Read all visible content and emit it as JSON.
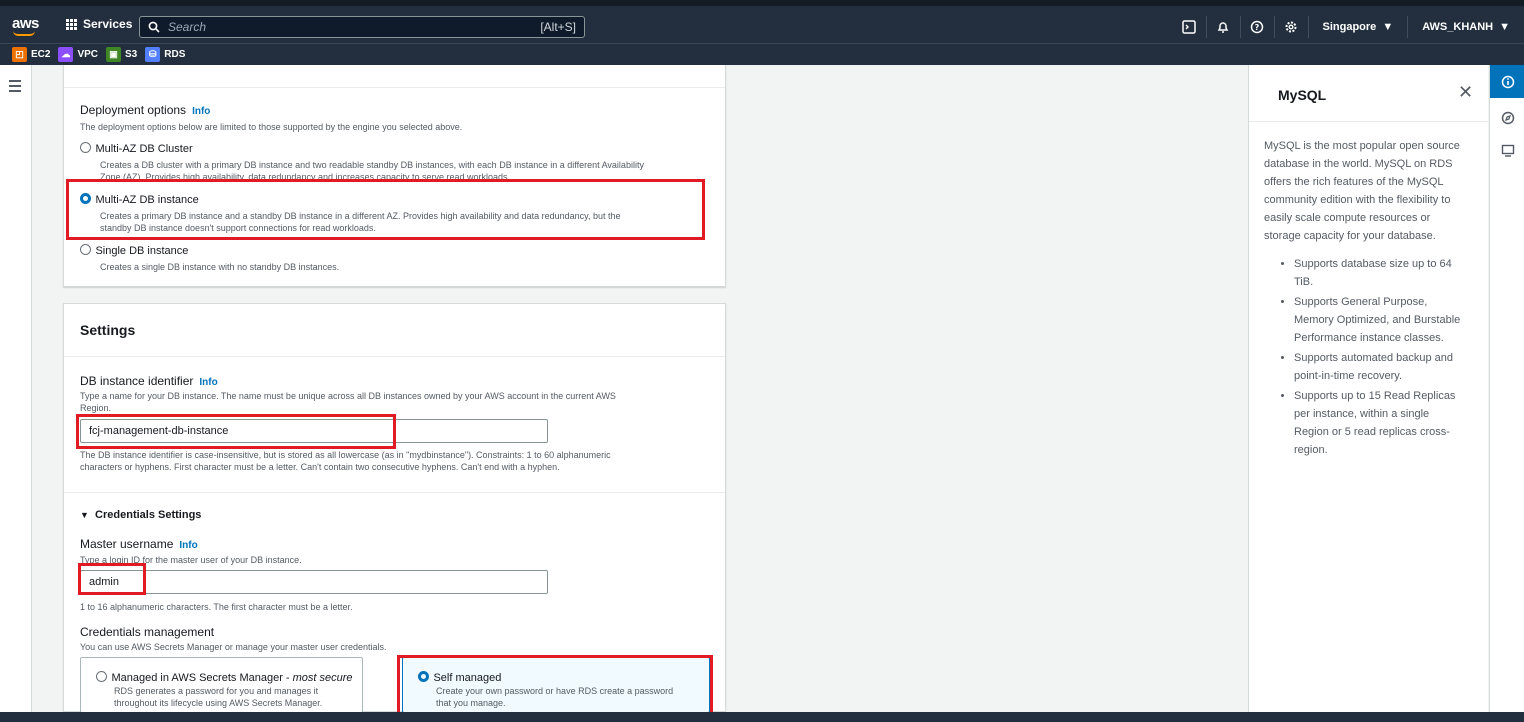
{
  "topbar": {
    "logo": "aws",
    "services_label": "Services",
    "search_placeholder": "Search",
    "search_shortcut": "[Alt+S]",
    "region": "Singapore",
    "account": "AWS_KHANH"
  },
  "favorites": [
    {
      "label": "EC2",
      "color": "#ed7100"
    },
    {
      "label": "VPC",
      "color": "#8c4fff"
    },
    {
      "label": "S3",
      "color": "#3f8624"
    },
    {
      "label": "RDS",
      "color": "#527fff"
    }
  ],
  "deployment": {
    "heading": "Deployment options",
    "info": "Info",
    "description": "The deployment options below are limited to those supported by the engine you selected above.",
    "options": [
      {
        "title": "Multi-AZ DB Cluster",
        "desc1": "Creates a DB cluster with a primary DB instance and two readable standby DB instances, with each DB instance in a different Availability",
        "desc2": "Zone (AZ). Provides high availability, data redundancy and increases capacity to serve read workloads.",
        "selected": false
      },
      {
        "title": "Multi-AZ DB instance",
        "desc1": "Creates a primary DB instance and a standby DB instance in a different AZ. Provides high availability and data redundancy, but the",
        "desc2": "standby DB instance doesn't support connections for read workloads.",
        "selected": true
      },
      {
        "title": "Single DB instance",
        "desc1": "Creates a single DB instance with no standby DB instances.",
        "desc2": "",
        "selected": false
      }
    ]
  },
  "settings": {
    "heading": "Settings",
    "identifier": {
      "label": "DB instance identifier",
      "info": "Info",
      "desc1": "Type a name for your DB instance. The name must be unique across all DB instances owned by your AWS account in the current AWS",
      "desc2": "Region.",
      "value": "fcj-management-db-instance",
      "hint1": "The DB instance identifier is case-insensitive, but is stored as all lowercase (as in \"mydbinstance\"). Constraints: 1 to 60 alphanumeric",
      "hint2": "characters or hyphens. First character must be a letter. Can't contain two consecutive hyphens. Can't end with a hyphen."
    },
    "credentials": {
      "heading": "Credentials Settings",
      "username_label": "Master username",
      "info": "Info",
      "username_desc": "Type a login ID for the master user of your DB instance.",
      "username_value": "admin",
      "username_hint": "1 to 16 alphanumeric characters. The first character must be a letter.",
      "mgmt_label": "Credentials management",
      "mgmt_desc": "You can use AWS Secrets Manager or manage your master user credentials.",
      "managed": {
        "title": "Managed in AWS Secrets Manager - ",
        "title_em": "most secure",
        "desc1": "RDS generates a password for you and manages it",
        "desc2": "throughout its lifecycle using AWS Secrets Manager.",
        "selected": false
      },
      "self": {
        "title": "Self managed",
        "desc1": "Create your own password or have RDS create a password",
        "desc2": "that you manage.",
        "selected": true
      }
    }
  },
  "help_panel": {
    "title": "MySQL",
    "intro": "MySQL is the most popular open source database in the world. MySQL on RDS offers the rich features of the MySQL community edition with the flexibility to easily scale compute resources or storage capacity for your database.",
    "bullets": [
      "Supports database size up to 64 TiB.",
      "Supports General Purpose, Memory Optimized, and Burstable Performance instance classes.",
      "Supports automated backup and point-in-time recovery.",
      "Supports up to 15 Read Replicas per instance, within a single Region or 5 read replicas cross-region."
    ]
  },
  "colors": {
    "accent": "#0073bb",
    "highlight": "#e01b24",
    "nav": "#232f3e"
  }
}
